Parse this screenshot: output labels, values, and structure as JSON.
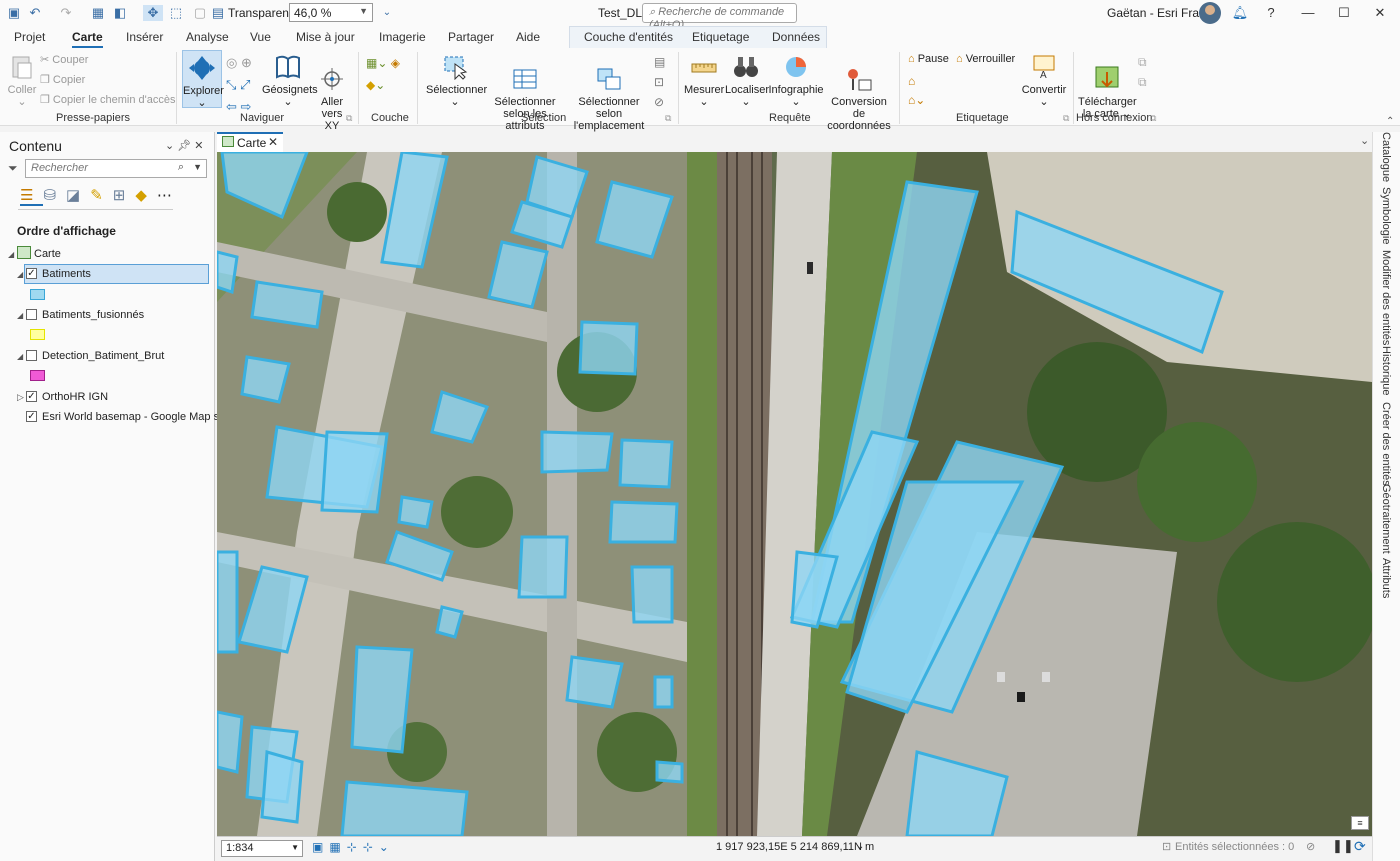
{
  "titlebar": {
    "transparency_label": "Transparence",
    "transparency_value": "46,0 %",
    "doc_title": "Test_DL",
    "command_search_placeholder": "Recherche de commande (Alt+Q)",
    "user": "Gaëtan - Esri France",
    "help": "?"
  },
  "tabs": [
    "Projet",
    "Carte",
    "Insérer",
    "Analyse",
    "Vue",
    "Mise à jour",
    "Imagerie",
    "Partager",
    "Aide"
  ],
  "context_tabs": [
    "Couche d'entités",
    "Etiquetage",
    "Données"
  ],
  "ribbon": {
    "clipboard": {
      "paste": "Coller",
      "cut": "Couper",
      "copy": "Copier",
      "copy_path": "Copier le chemin d'accès",
      "group": "Presse-papiers"
    },
    "navigate": {
      "explore": "Explorer",
      "bookmarks": "Géosignets",
      "goto_xy": "Aller\nvers XY",
      "group": "Naviguer"
    },
    "layer": {
      "group": "Couche"
    },
    "selection": {
      "select": "Sélectionner",
      "by_attr": "Sélectionner\nselon les attributs",
      "by_loc": "Sélectionner selon\nl'emplacement",
      "group": "Sélection"
    },
    "inquiry": {
      "measure": "Mesurer",
      "locate": "Localiser",
      "infographic": "Infographie",
      "convert_coords": "Conversion de\ncoordonnées",
      "group": "Requête"
    },
    "labeling": {
      "pause": "Pause",
      "lock": "Verrouiller",
      "convert": "Convertir",
      "group": "Etiquetage"
    },
    "offline": {
      "download": "Télécharger\nla carte",
      "group": "Hors connexion"
    }
  },
  "contents": {
    "title": "Contenu",
    "search_placeholder": "Rechercher",
    "draw_order": "Ordre d'affichage",
    "map_name": "Carte",
    "layers": [
      {
        "name": "Batiments",
        "checked": true,
        "swatch": "#9fd9f0",
        "swatch_border": "#3aa6d6",
        "selected": true
      },
      {
        "name": "Batiments_fusionnés",
        "checked": false,
        "swatch": "#ffff9e",
        "swatch_border": "#e4e400"
      },
      {
        "name": "Detection_Batiment_Brut",
        "checked": false,
        "swatch": "#f05ad6",
        "swatch_border": "#a0208a"
      },
      {
        "name": "OrthoHR IGN",
        "checked": true
      },
      {
        "name": "Esri World basemap - Google Map s...",
        "checked": true
      }
    ]
  },
  "map": {
    "tab": "Carte"
  },
  "status": {
    "scale": "1:834",
    "coords": "1 917 923,15E 5 214 869,11N m",
    "selected": "Entités sélectionnées : 0"
  },
  "dock_tabs": [
    "Catalogue",
    "Symbologie",
    "Modifier des entités",
    "Historique",
    "Créer des entités",
    "Géotraitement",
    "Attributs"
  ],
  "colors": {
    "accent": "#1f6fb5",
    "building_fill": "#8fd6f4",
    "building_stroke": "#3ab0e0"
  }
}
